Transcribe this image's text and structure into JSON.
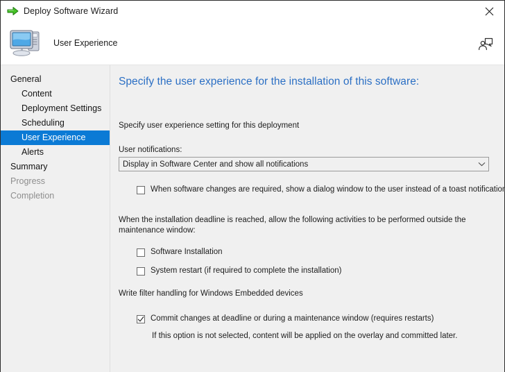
{
  "titlebar": {
    "title": "Deploy Software Wizard",
    "icon": "green-arrow-icon",
    "close_label": "✕"
  },
  "header": {
    "title": "User Experience",
    "icon": "computer-icon",
    "feedback_icon": "feedback-person-icon"
  },
  "sidebar": {
    "items": [
      {
        "label": "General",
        "level": "parent",
        "state": "normal"
      },
      {
        "label": "Content",
        "level": "child",
        "state": "normal"
      },
      {
        "label": "Deployment Settings",
        "level": "child",
        "state": "normal"
      },
      {
        "label": "Scheduling",
        "level": "child",
        "state": "normal"
      },
      {
        "label": "User Experience",
        "level": "child",
        "state": "selected"
      },
      {
        "label": "Alerts",
        "level": "child",
        "state": "normal"
      },
      {
        "label": "Summary",
        "level": "parent",
        "state": "normal"
      },
      {
        "label": "Progress",
        "level": "parent",
        "state": "disabled"
      },
      {
        "label": "Completion",
        "level": "parent",
        "state": "disabled"
      }
    ]
  },
  "main": {
    "page_title": "Specify the user experience for the installation of this software:",
    "intro_text": "Specify user experience setting for this deployment",
    "notifications": {
      "label": "User notifications:",
      "selected": "Display in Software Center and show all notifications",
      "options": [
        "Display in Software Center and show all notifications"
      ]
    },
    "dialog_checkbox": {
      "label": "When software changes are required, show a dialog window to the user instead of a toast notification",
      "checked": false
    },
    "deadline_paragraph": "When the installation deadline is reached, allow the following activities to be performed outside the maintenance window:",
    "deadline_options": [
      {
        "label": "Software Installation",
        "checked": false
      },
      {
        "label": "System restart  (if required to complete the installation)",
        "checked": false
      }
    ],
    "write_filter": {
      "section_label": "Write filter handling for Windows Embedded devices",
      "commit_checkbox": {
        "label": "Commit changes at deadline or during a maintenance window (requires restarts)",
        "checked": true
      },
      "hint": "If this option is not selected, content will be applied on the overlay and committed later."
    }
  },
  "colors": {
    "accent_blue": "#0b7ad5",
    "title_blue": "#2b6fc4",
    "sidebar_bg": "#f0f0f0",
    "content_bg": "#f0f0f0",
    "arrow_green": "#3cb315"
  }
}
